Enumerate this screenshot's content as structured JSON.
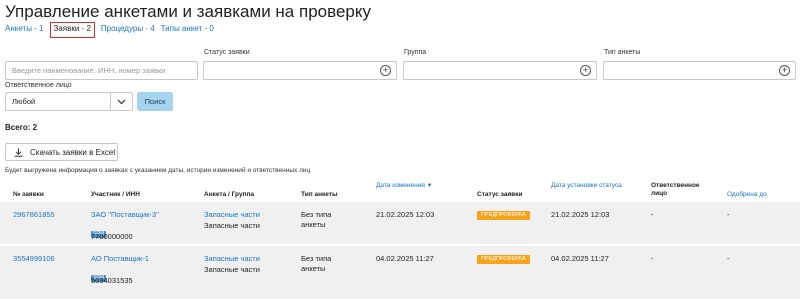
{
  "page": {
    "title": "Управление анкетами и заявками на проверку"
  },
  "tabs": [
    {
      "label": "Анкеты - 1"
    },
    {
      "label": "Заявки - 2"
    },
    {
      "label": "Процедуры - 4"
    },
    {
      "label": "Типы анкет - 0"
    }
  ],
  "filters": {
    "search_placeholder": "Введите наименование, ИНН, номер заявки",
    "status_label": "Статус заявки",
    "group_label": "Группа",
    "type_label": "Тип анкеты",
    "responsible_label": "Ответственное лицо",
    "responsible_value": "Любой",
    "search_button": "Поиск"
  },
  "summary": {
    "total": "Всего: 2"
  },
  "export": {
    "button": "Скачать заявки в Excel",
    "note": "Будет выгружена информация о заявках с указанием даты, истории изменений и ответственных лиц"
  },
  "table": {
    "headers": {
      "number": "№ заявки",
      "participant": "Участник / ИНН",
      "form_group": "Анкета / Группа",
      "form_type": "Тип анкеты",
      "changed": "Дата изменения",
      "sort_arrow": "▼",
      "status": "Статус заявки",
      "status_date": "Дата установки статуса",
      "responsible": "Ответственное лицо",
      "approved": "Одобрена до"
    },
    "rows": [
      {
        "number": "2967861855",
        "participant": "ЗАО \"Поставщик-3\"",
        "badge": "SRM",
        "inn": "7700000000",
        "form": "Запасные части",
        "group": "Запасные части",
        "type": "Без типа анкеты",
        "changed": "21.02.2025 12:03",
        "status": "ПРЕДПРОВЕРКА",
        "status_date": "21.02.2025 12:03",
        "responsible": "-",
        "approved": "-"
      },
      {
        "number": "3554999106",
        "participant": "АО Поставщик-1",
        "badge": "SRM",
        "inn": "5034031535",
        "form": "Запасные части",
        "group": "Запасные части",
        "type": "Без типа анкеты",
        "changed": "04.02.2025 11:27",
        "status": "ПРЕДПРОВЕРКА",
        "status_date": "04.02.2025 11:27",
        "responsible": "-",
        "approved": "-"
      }
    ]
  },
  "colors": {
    "link": "#1a73c9",
    "status_badge": "#f5a41c",
    "active_tab_border": "#d0312d",
    "search_button": "#a5d4ef"
  },
  "icons": {
    "add": "plus-circle-icon",
    "dropdown": "chevron-down-icon",
    "download": "download-icon"
  }
}
